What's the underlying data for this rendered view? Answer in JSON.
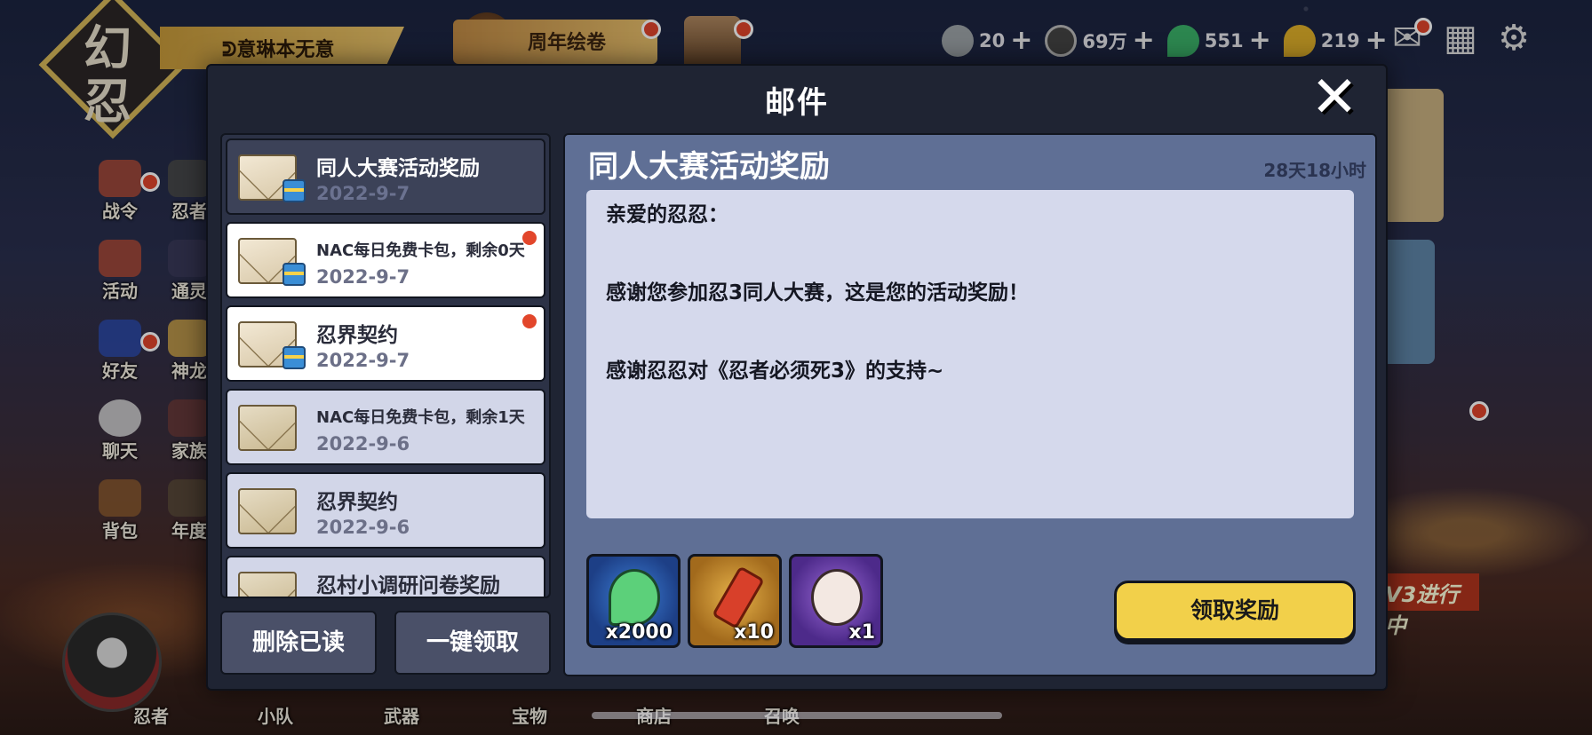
{
  "background": {
    "logo_chars": [
      "幻",
      "忍"
    ],
    "player_name": "ᕲ意琳本无意",
    "event_banner": "周年绘卷",
    "resources": [
      {
        "icon": "onigiri-icon",
        "value": "20"
      },
      {
        "icon": "coin-icon",
        "value": "69万"
      },
      {
        "icon": "green-magatama-icon",
        "value": "551"
      },
      {
        "icon": "gold-magatama-icon",
        "value": "219"
      }
    ],
    "side_menu": [
      "战令",
      "活动",
      "好友",
      "聊天",
      "背包"
    ],
    "side_menu2": [
      "忍者",
      "通灵",
      "神龙",
      "家族",
      "年度"
    ],
    "bottom_nav": [
      "忍者",
      "小队",
      "武器",
      "宝物",
      "商店",
      "召唤"
    ],
    "v3_banner": "V3进行中"
  },
  "modal": {
    "title": "邮件",
    "close_symbol": "✕",
    "mails": [
      {
        "title": "同人大赛活动奖励",
        "date": "2022-9-7",
        "state": "selected",
        "opened": false,
        "unread": false
      },
      {
        "title": "NAC每日免费卡包，剩余0天",
        "date": "2022-9-7",
        "state": "unread",
        "opened": false,
        "unread": true
      },
      {
        "title": "忍界契约",
        "date": "2022-9-7",
        "state": "unread",
        "opened": false,
        "unread": true
      },
      {
        "title": "NAC每日免费卡包，剩余1天",
        "date": "2022-9-6",
        "state": "read",
        "opened": true,
        "unread": false
      },
      {
        "title": "忍界契约",
        "date": "2022-9-6",
        "state": "read",
        "opened": true,
        "unread": false
      },
      {
        "title": "忍村小调研问卷奖励",
        "date": "",
        "state": "read",
        "opened": true,
        "unread": false
      }
    ],
    "delete_read_label": "删除已读",
    "claim_all_label": "一键领取",
    "detail": {
      "title": "同人大赛活动奖励",
      "remaining": "28天18小时",
      "body": [
        "亲爱的忍忍：",
        "",
        "感谢您参加忍3同人大赛，这是您的活动奖励！",
        "",
        "感谢忍忍对《忍者必须死3》的支持~"
      ],
      "rewards": [
        {
          "icon": "green-magatama-icon",
          "qty": "x2000"
        },
        {
          "icon": "scroll-ticket-icon",
          "qty": "x10"
        },
        {
          "icon": "ninja-avatar-icon",
          "qty": "x1"
        }
      ],
      "claim_label": "领取奖励"
    }
  }
}
